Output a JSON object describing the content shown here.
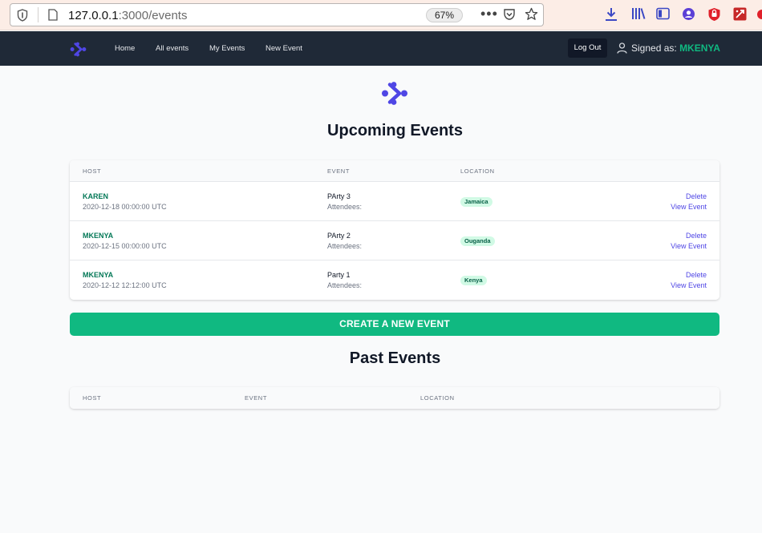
{
  "browser": {
    "url_host": "127.0.0.1",
    "url_path": ":3000/events",
    "zoom": "67%"
  },
  "nav": {
    "links": [
      "Home",
      "All events",
      "My Events",
      "New Event"
    ],
    "logout_label": "Log Out",
    "signed_as_label": "Signed as:",
    "username": "MKENYA"
  },
  "upcoming": {
    "title": "Upcoming Events",
    "columns": [
      "HOST",
      "EVENT",
      "LOCATION"
    ],
    "rows": [
      {
        "host": "KAREN",
        "date": "2020-12-18 00:00:00 UTC",
        "event": "PArty 3",
        "attendees": "Attendees:",
        "location": "Jamaica",
        "delete": "Delete",
        "view": "View Event"
      },
      {
        "host": "MKENYA",
        "date": "2020-12-15 00:00:00 UTC",
        "event": "PArty 2",
        "attendees": "Attendees:",
        "location": "Ouganda",
        "delete": "Delete",
        "view": "View Event"
      },
      {
        "host": "MKENYA",
        "date": "2020-12-12 12:12:00 UTC",
        "event": "Party 1",
        "attendees": "Attendees:",
        "location": "Kenya",
        "delete": "Delete",
        "view": "View Event"
      }
    ]
  },
  "create_button": "CREATE A NEW EVENT",
  "past": {
    "title": "Past Events",
    "columns": [
      "HOST",
      "EVENT",
      "LOCATION"
    ]
  },
  "colors": {
    "nav_bg": "#1f2937",
    "accent_green": "#10b981",
    "host_green": "#047857",
    "link_indigo": "#4f46e5",
    "badge_bg": "#d1fae5",
    "logo_indigo": "#4f46e5"
  },
  "icons": [
    "shield-icon",
    "page-icon",
    "more-dots-icon",
    "pocket-icon",
    "star-icon",
    "download-icon",
    "library-icon",
    "sidebar-icon",
    "account-icon",
    "ublock-icon",
    "extension-icon",
    "brand-logo-icon",
    "user-icon"
  ]
}
